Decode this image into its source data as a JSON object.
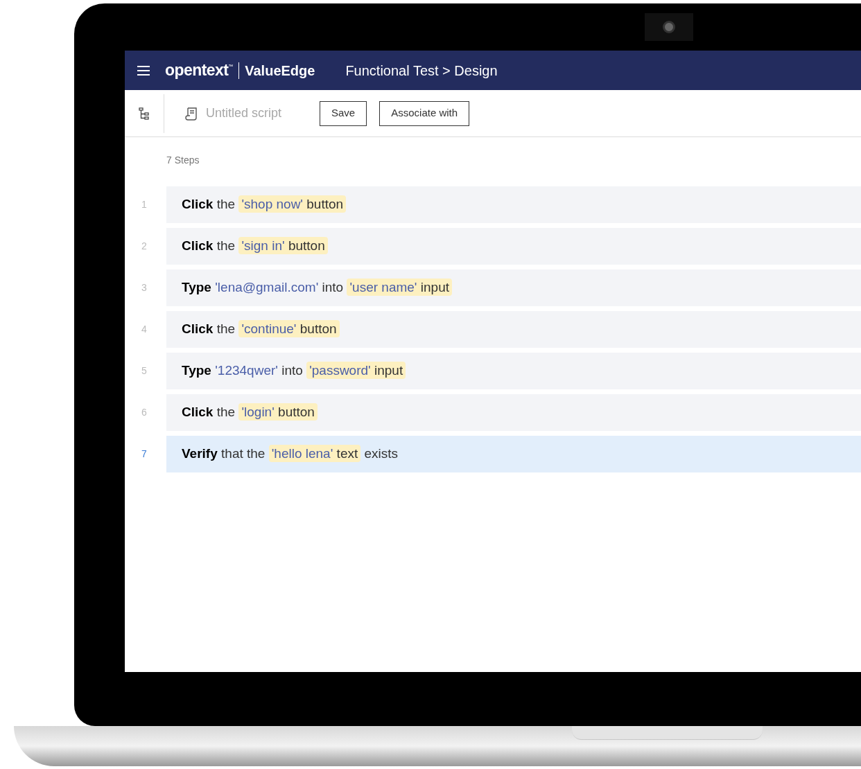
{
  "header": {
    "logo": "opentext",
    "trademark": "™",
    "product": "ValueEdge",
    "breadcrumb": "Functional Test > Design"
  },
  "toolbar": {
    "script_name": {
      "placeholder": "Untitled script"
    },
    "buttons": [
      "Save",
      "Associate with"
    ]
  },
  "steps_count": "7 Steps",
  "steps": [
    {
      "number": "1",
      "selected": false,
      "parts": [
        {
          "kind": "verb",
          "text": "Click"
        },
        {
          "kind": "plain",
          "text": "the"
        },
        {
          "kind": "target",
          "name": "'shop now'",
          "type": "button"
        }
      ]
    },
    {
      "number": "2",
      "selected": false,
      "parts": [
        {
          "kind": "verb",
          "text": "Click"
        },
        {
          "kind": "plain",
          "text": "the"
        },
        {
          "kind": "target",
          "name": "'sign in'",
          "type": "button"
        }
      ]
    },
    {
      "number": "3",
      "selected": false,
      "parts": [
        {
          "kind": "verb",
          "text": "Type"
        },
        {
          "kind": "value",
          "text": "'lena@gmail.com'"
        },
        {
          "kind": "plain",
          "text": "into"
        },
        {
          "kind": "target",
          "name": "'user name'",
          "type": "input"
        }
      ]
    },
    {
      "number": "4",
      "selected": false,
      "parts": [
        {
          "kind": "verb",
          "text": "Click"
        },
        {
          "kind": "plain",
          "text": "the"
        },
        {
          "kind": "target",
          "name": "'continue'",
          "type": "button"
        }
      ]
    },
    {
      "number": "5",
      "selected": false,
      "parts": [
        {
          "kind": "verb",
          "text": "Type"
        },
        {
          "kind": "value",
          "text": "'1234qwer'"
        },
        {
          "kind": "plain",
          "text": "into"
        },
        {
          "kind": "target",
          "name": "'password'",
          "type": "input"
        }
      ]
    },
    {
      "number": "6",
      "selected": false,
      "parts": [
        {
          "kind": "verb",
          "text": "Click"
        },
        {
          "kind": "plain",
          "text": "the"
        },
        {
          "kind": "target",
          "name": "'login'",
          "type": "button"
        }
      ]
    },
    {
      "number": "7",
      "selected": true,
      "parts": [
        {
          "kind": "verb",
          "text": "Verify"
        },
        {
          "kind": "plain",
          "text": "that the"
        },
        {
          "kind": "target",
          "name": "'hello lena'",
          "type": "text"
        },
        {
          "kind": "plain",
          "text": "exists"
        }
      ]
    }
  ]
}
